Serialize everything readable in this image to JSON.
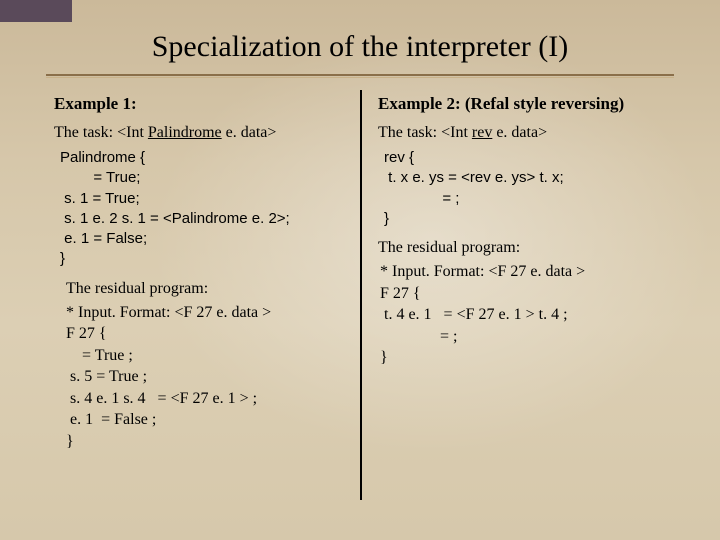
{
  "title": "Specialization of the interpreter (I)",
  "left": {
    "heading": "Example 1:",
    "taskPrefix": "The task: <Int ",
    "taskName": "Palindrome",
    "taskSuffix": "  e. data>",
    "code": "Palindrome {\n        = True;\n s. 1 = True;\n s. 1 e. 2 s. 1 = <Palindrome e. 2>;\n e. 1 = False;\n}",
    "residualHead": "The residual program:",
    "residual": "* Input. Format: <F 27 e. data >\nF 27 {\n    = True ;\n s. 5 = True ;\n s. 4 e. 1 s. 4   = <F 27 e. 1 > ;\n e. 1  = False ;\n}"
  },
  "right": {
    "heading": "Example 2: (Refal style reversing)",
    "taskPrefix": "The task: <Int ",
    "taskName": "rev",
    "taskSuffix": "  e. data>",
    "code": "rev {\n t. x e. ys = <rev e. ys> t. x;\n              = ;\n}",
    "residualHead": "The residual program:",
    "residual": "* Input. Format: <F 27 e. data >\nF 27 {\n t. 4 e. 1   = <F 27 e. 1 > t. 4 ;\n               = ;\n}"
  }
}
